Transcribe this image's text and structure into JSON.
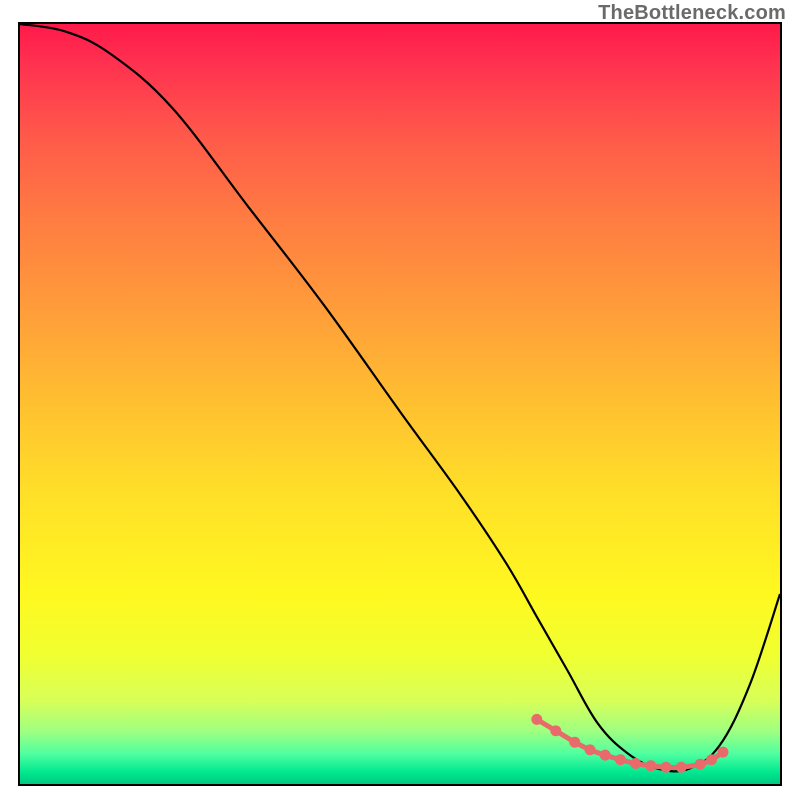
{
  "watermark": "TheBottleneck.com",
  "chart_data": {
    "type": "line",
    "title": "",
    "xlabel": "",
    "ylabel": "",
    "xlim": [
      0,
      100
    ],
    "ylim": [
      0,
      100
    ],
    "grid": false,
    "series": [
      {
        "name": "bottleneck-curve",
        "color": "#000000",
        "x": [
          0,
          6,
          12,
          20,
          30,
          40,
          50,
          58,
          64,
          68,
          72,
          76,
          80,
          84,
          88,
          92,
          96,
          100
        ],
        "y": [
          100,
          99,
          96,
          89,
          76,
          63,
          49,
          38,
          29,
          22,
          15,
          8,
          4,
          2,
          2,
          5,
          13,
          25
        ]
      }
    ],
    "highlight": {
      "color": "#e86a6a",
      "radius_px": 5.5,
      "x": [
        68,
        70.5,
        73,
        75,
        77,
        79,
        81,
        83,
        85,
        87,
        89.5,
        91,
        92.5
      ],
      "y": [
        8.5,
        7,
        5.5,
        4.5,
        3.8,
        3.2,
        2.7,
        2.4,
        2.2,
        2.2,
        2.6,
        3.2,
        4.2
      ]
    }
  }
}
